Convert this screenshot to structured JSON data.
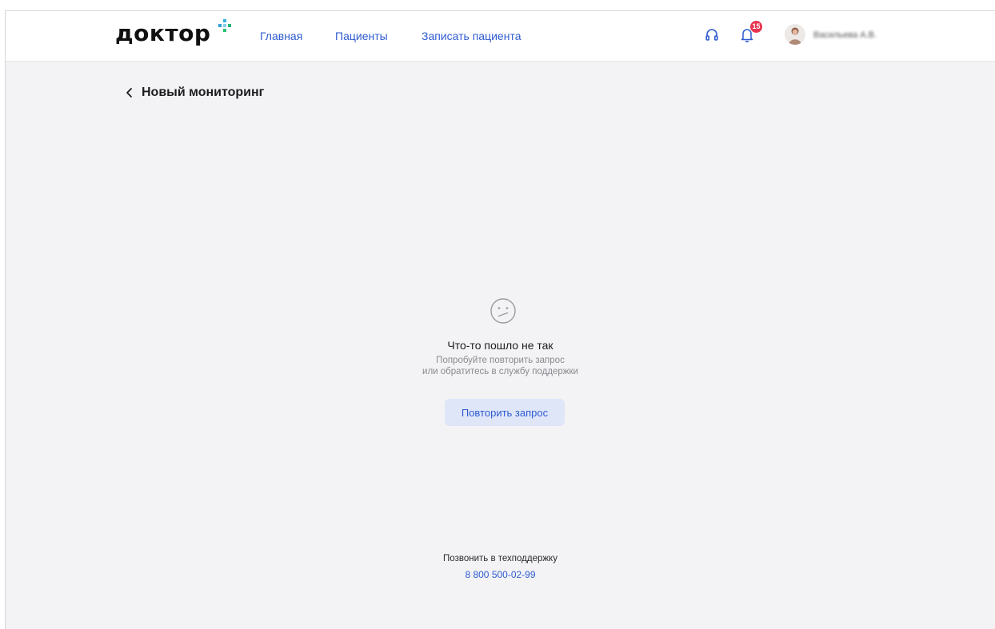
{
  "header": {
    "logo_text": "доктор",
    "nav": [
      {
        "label": "Главная"
      },
      {
        "label": "Пациенты"
      },
      {
        "label": "Записать пациента"
      }
    ],
    "notifications_count": "15",
    "user_name": "Васильева А.В.",
    "icons": [
      "headset-icon",
      "bell-icon"
    ]
  },
  "page": {
    "title": "Новый мониторинг"
  },
  "error": {
    "icon": "sad-face-icon",
    "title": "Что-то пошло не так",
    "subtitle_line1": "Попробуйте повторить запрос",
    "subtitle_line2": "или обратитесь в службу поддержки",
    "retry_label": "Повторить запрос"
  },
  "support": {
    "label": "Позвонить в техподдержку",
    "phone": "8 800 500-02-99"
  },
  "colors": {
    "accent": "#2f5bd1",
    "badge": "#e8344e",
    "background": "#f3f3f5",
    "button_bg": "#dfe6f8"
  }
}
